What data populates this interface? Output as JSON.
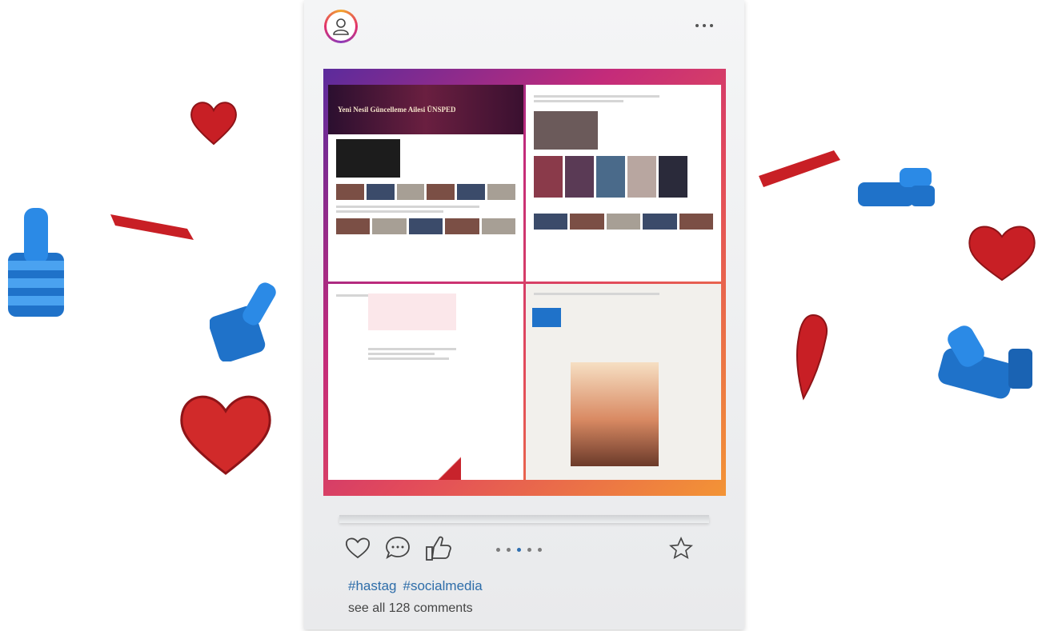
{
  "post": {
    "avatar_icon": "user-icon",
    "more_icon": "ellipsis-icon",
    "tags": [
      "#hastag",
      "#socialmedia"
    ],
    "comments_link": "see all 128 comments",
    "carousel": {
      "total": 5,
      "active_index": 3
    },
    "frame_title": "Yeni Nesil Güncelleme Ailesi ÜNSPED",
    "actions": {
      "like_icon": "heart-icon",
      "comment_icon": "comment-icon",
      "thumbs_icon": "thumbs-up-icon",
      "save_icon": "star-icon"
    }
  },
  "colors": {
    "accent": "#2e6da9",
    "heart_red": "#d12a2a",
    "thumb_blue": "#1f7ad6",
    "gradient_start": "#5b2b9c",
    "gradient_end": "#f39435"
  }
}
